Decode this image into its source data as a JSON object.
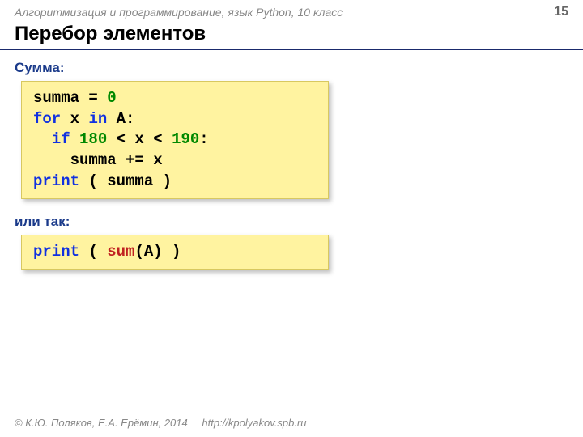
{
  "header": {
    "course": "Алгоритмизация и программирование, язык Python, 10 класс",
    "page": "15"
  },
  "title": "Перебор элементов",
  "section1": "Сумма:",
  "code1": {
    "l1a": "summa",
    "l1b": " = ",
    "l1c": "0",
    "l2a": "for",
    "l2b": " x ",
    "l2c": "in",
    "l2d": " A:",
    "l3a": "  ",
    "l3b": "if",
    "l3c": " ",
    "l3d": "180",
    "l3e": " < x < ",
    "l3f": "190",
    "l3g": ":",
    "l4a": "    summa += x",
    "l5a": "print",
    "l5b": " ( summa )"
  },
  "section2": "или так:",
  "code2": {
    "a": "print",
    "b": " ( ",
    "c": "sum",
    "d": "(A) )"
  },
  "footer": {
    "credit": "© К.Ю. Поляков, Е.А. Ерёмин, 2014",
    "url": "http://kpolyakov.spb.ru"
  }
}
